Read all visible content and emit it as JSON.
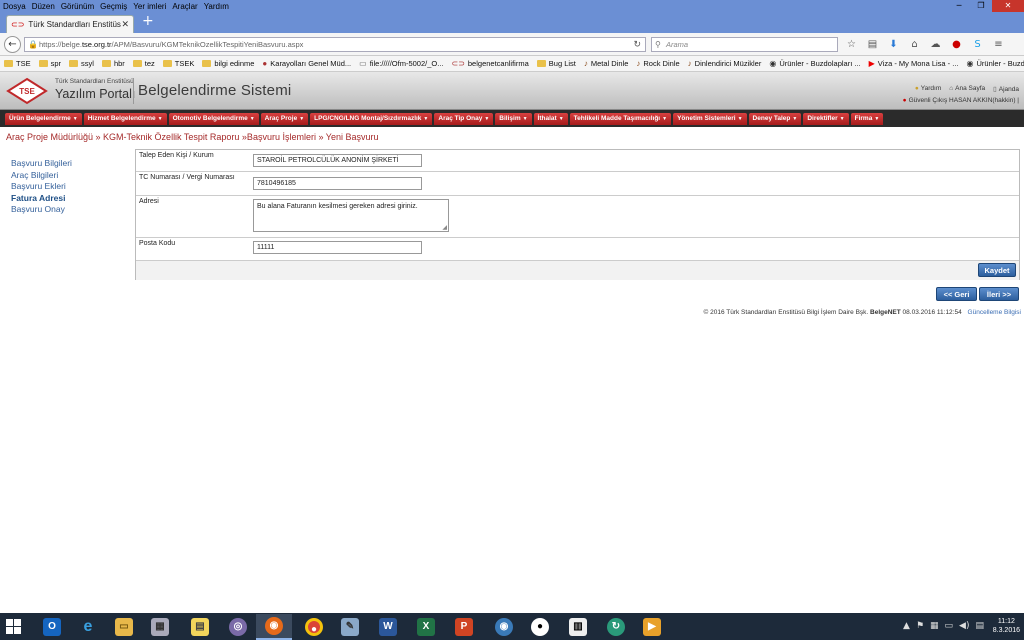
{
  "firefox_menu": [
    "Dosya",
    "Düzen",
    "Görünüm",
    "Geçmiş",
    "Yer imleri",
    "Araçlar",
    "Yardım"
  ],
  "tab": {
    "title": "Türk Standardları Enstitüs..."
  },
  "url": {
    "prefix": "https://belge.",
    "domain": "tse.org.tr",
    "path": "/APM/Basvuru/KGMTeknikOzellikTespitiYeniBasvuru.aspx"
  },
  "search": {
    "placeholder": "Arama"
  },
  "bookmarks": [
    {
      "label": "TSE",
      "icon": "folder"
    },
    {
      "label": "spr",
      "icon": "folder"
    },
    {
      "label": "ssyl",
      "icon": "folder"
    },
    {
      "label": "hbr",
      "icon": "folder"
    },
    {
      "label": "tez",
      "icon": "folder"
    },
    {
      "label": "TSEK",
      "icon": "folder"
    },
    {
      "label": "bilgi edinme",
      "icon": "folder"
    },
    {
      "label": "Karayolları Genel Müd...",
      "icon": "site"
    },
    {
      "label": "file://///Ofm-5002/_O...",
      "icon": "file"
    },
    {
      "label": "belgenetcanlifirma",
      "icon": "site"
    },
    {
      "label": "Bug List",
      "icon": "folder"
    },
    {
      "label": "Metal Dinle",
      "icon": "guitar"
    },
    {
      "label": "Rock Dinle",
      "icon": "guitar"
    },
    {
      "label": "Dinlendirici Müzikler",
      "icon": "guitar"
    },
    {
      "label": "Ürünler - Buzdolapları ...",
      "icon": "site"
    },
    {
      "label": "Viza - My Mona Lisa - ...",
      "icon": "youtube"
    },
    {
      "label": "Ürünler - Buzdolapları ...",
      "icon": "site"
    }
  ],
  "header": {
    "brand_small": "Türk Standardları Enstitüsü",
    "brand_big": "Yazılım Portalı",
    "system_title": "Belgelendirme Sistemi",
    "logo_text": "TSE",
    "links": [
      "Yardım",
      "Ana Sayfa",
      "Ajanda"
    ],
    "user": "Güvenli Çıkış HASAN AKKIN(hakkin) |"
  },
  "menu": [
    "Ürün Belgelendirme",
    "Hizmet Belgelendirme",
    "Otomotiv Belgelendirme",
    "Araç Proje",
    "LPG/CNG/LNG Montaj/Sızdırmazlık",
    "Araç Tip Onay",
    "Bilişim",
    "İthalat",
    "Tehlikeli Madde Taşımacılığı",
    "Yönetim Sistemleri",
    "Deney Talep",
    "Direktifler",
    "Firma"
  ],
  "breadcrumb": "Araç Proje Müdürlüğü » KGM-Teknik Özellik Tespit Raporu »Başvuru İşlemleri » Yeni Başvuru",
  "leftnav": [
    "Başvuru Bilgileri",
    "Araç Bilgileri",
    "Başvuru Ekleri",
    "Fatura Adresi",
    "Başvuru Onay"
  ],
  "form": {
    "talep_label": "Talep Eden Kişi / Kurum",
    "talep_value": "STAROİL PETROLCÜLÜK ANONİM ŞİRKETİ",
    "tc_label": "TC Numarası / Vergi Numarası",
    "tc_value": "7810496185",
    "adres_label": "Adresi",
    "adres_value": "Bu alana Faturanın kesilmesi gereken adresi giriniz.",
    "posta_label": "Posta Kodu",
    "posta_value": "11111",
    "save": "Kaydet"
  },
  "nav_buttons": {
    "back": "<< Geri",
    "next": "İleri >>"
  },
  "footer": {
    "text": "© 2016 Türk Standardları Enstitüsü Bilgi İşlem Daire Bşk.",
    "brand": "BelgeNET",
    "date": "08.03.2016 11:12:54",
    "link": "Güncelleme Bilgisi"
  },
  "clock": {
    "time": "11:12",
    "date": "8.3.2016"
  },
  "colors": {
    "accent_red": "#c0282a",
    "button_blue": "#3a6fb0",
    "link_blue": "#35619b"
  }
}
